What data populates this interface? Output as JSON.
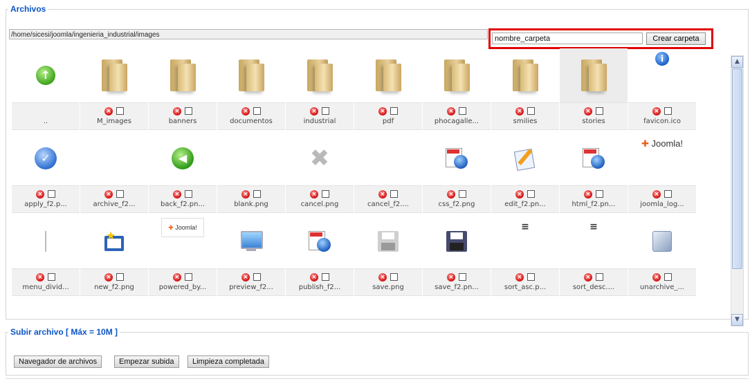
{
  "archivos": {
    "legend": "Archivos",
    "path": "/home/sicesi/joomla/ingenieria_industrial/images",
    "folder_input_value": "nombre_carpeta",
    "create_button": "Crear carpeta"
  },
  "items": [
    {
      "name": "..",
      "icon": "up-arrow-icon",
      "controls": false
    },
    {
      "name": "M_images",
      "icon": "folder-icon",
      "controls": true
    },
    {
      "name": "banners",
      "icon": "folder-icon",
      "controls": true
    },
    {
      "name": "documentos",
      "icon": "folder-icon",
      "controls": true
    },
    {
      "name": "industrial",
      "icon": "folder-icon",
      "controls": true
    },
    {
      "name": "pdf",
      "icon": "folder-icon",
      "controls": true
    },
    {
      "name": "phocagalle...",
      "icon": "folder-icon",
      "controls": true
    },
    {
      "name": "smilies",
      "icon": "folder-icon",
      "controls": true
    },
    {
      "name": "stories",
      "icon": "folder-icon",
      "controls": true,
      "selected": true
    },
    {
      "name": "favicon.ico",
      "icon": "info-icon",
      "controls": true
    },
    {
      "name": "apply_f2.p...",
      "icon": "check-icon",
      "controls": true
    },
    {
      "name": "archive_f2...",
      "icon": "blank-icon",
      "controls": true
    },
    {
      "name": "back_f2.pn...",
      "icon": "back-arrow-icon",
      "controls": true
    },
    {
      "name": "blank.png",
      "icon": "blank-icon",
      "controls": true
    },
    {
      "name": "cancel.png",
      "icon": "cancel-x-icon",
      "controls": true
    },
    {
      "name": "cancel_f2....",
      "icon": "blank-icon",
      "controls": true
    },
    {
      "name": "css_f2.png",
      "icon": "css-globe-icon",
      "controls": true
    },
    {
      "name": "edit_f2.pn...",
      "icon": "edit-pencil-icon",
      "controls": true
    },
    {
      "name": "html_f2.pn...",
      "icon": "html-globe-icon",
      "controls": true
    },
    {
      "name": "joomla_log...",
      "icon": "joomla-logo-icon",
      "logo_text": "Joomla!",
      "controls": true
    },
    {
      "name": "menu_divid...",
      "icon": "divider-line-icon",
      "controls": true
    },
    {
      "name": "new_f2.png",
      "icon": "new-star-icon",
      "controls": true
    },
    {
      "name": "powered_by...",
      "icon": "powered-by-joomla-icon",
      "logo_text": "Joomla!",
      "controls": true
    },
    {
      "name": "preview_f2...",
      "icon": "monitor-icon",
      "controls": true
    },
    {
      "name": "publish_f2...",
      "icon": "publish-globe-icon",
      "controls": true
    },
    {
      "name": "save.png",
      "icon": "floppy-gray-icon",
      "controls": true
    },
    {
      "name": "save_f2.pn...",
      "icon": "floppy-dark-icon",
      "controls": true
    },
    {
      "name": "sort_asc.p...",
      "icon": "sort-asc-icon",
      "controls": true
    },
    {
      "name": "sort_desc....",
      "icon": "sort-desc-icon",
      "controls": true
    },
    {
      "name": "unarchive_...",
      "icon": "unarchive-box-icon",
      "controls": true
    },
    {
      "name": "",
      "icon": "partial-blue-icon",
      "controls": false
    },
    {
      "name": "",
      "icon": "partial-globe-icon",
      "controls": false
    }
  ],
  "subir": {
    "legend": "Subir archivo [ Máx = 10M ]",
    "browse_button": "Navegador de archivos",
    "start_button": "Empezar subida",
    "clear_button": "Limpieza completada"
  },
  "colors": {
    "legend": "#0b55c4",
    "highlight": "#e00000"
  }
}
